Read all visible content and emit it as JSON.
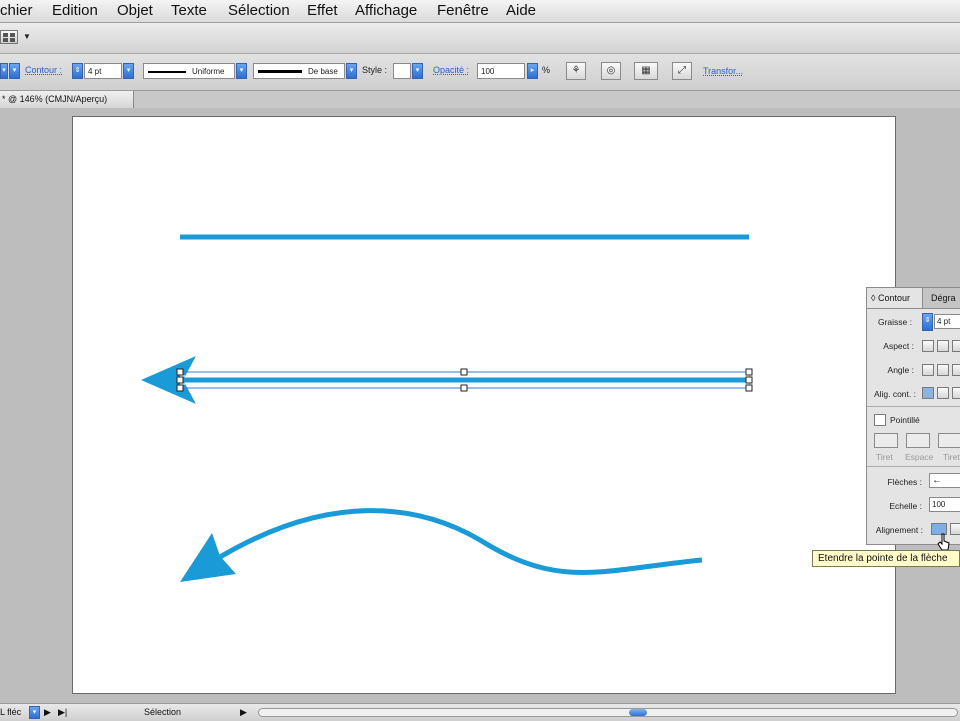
{
  "menubar": {
    "items": [
      "chier",
      "Edition",
      "Objet",
      "Texte",
      "Sélection",
      "Effet",
      "Affichage",
      "Fenêtre",
      "Aide"
    ]
  },
  "control_bar": {
    "contour_label": "Contour :",
    "weight_value": "4 pt",
    "profile_label": "Uniforme",
    "brush_label": "De base",
    "style_label": "Style :",
    "opacity_label": "Opacité :",
    "opacity_value": "100",
    "percent_sign": "%",
    "transform_label": "Transfor..."
  },
  "document": {
    "tab_title": "* @ 146% (CMJN/Aperçu)"
  },
  "artwork": {
    "stroke_color": "#1a9ad6"
  },
  "stroke_panel": {
    "tab_contour": "Contour",
    "tab_degrade": "Dégra",
    "graisse_label": "Graisse :",
    "graisse_value": "4 pt",
    "aspect_label": "Aspect :",
    "angle_label": "Angle :",
    "align_label": "Alig. cont. :",
    "pointille_label": "Pointillé",
    "dash_labels": [
      "Tiret",
      "Espace",
      "Tiret"
    ],
    "fleches_label": "Flèches :",
    "echelle_label": "Echelle :",
    "echelle_value": "100",
    "alignement_label": "Alignement :"
  },
  "tooltip": {
    "text": "Etendre la pointe de la flèche"
  },
  "statusbar": {
    "tool_name": "Sélection",
    "left_field": "L fléc"
  }
}
